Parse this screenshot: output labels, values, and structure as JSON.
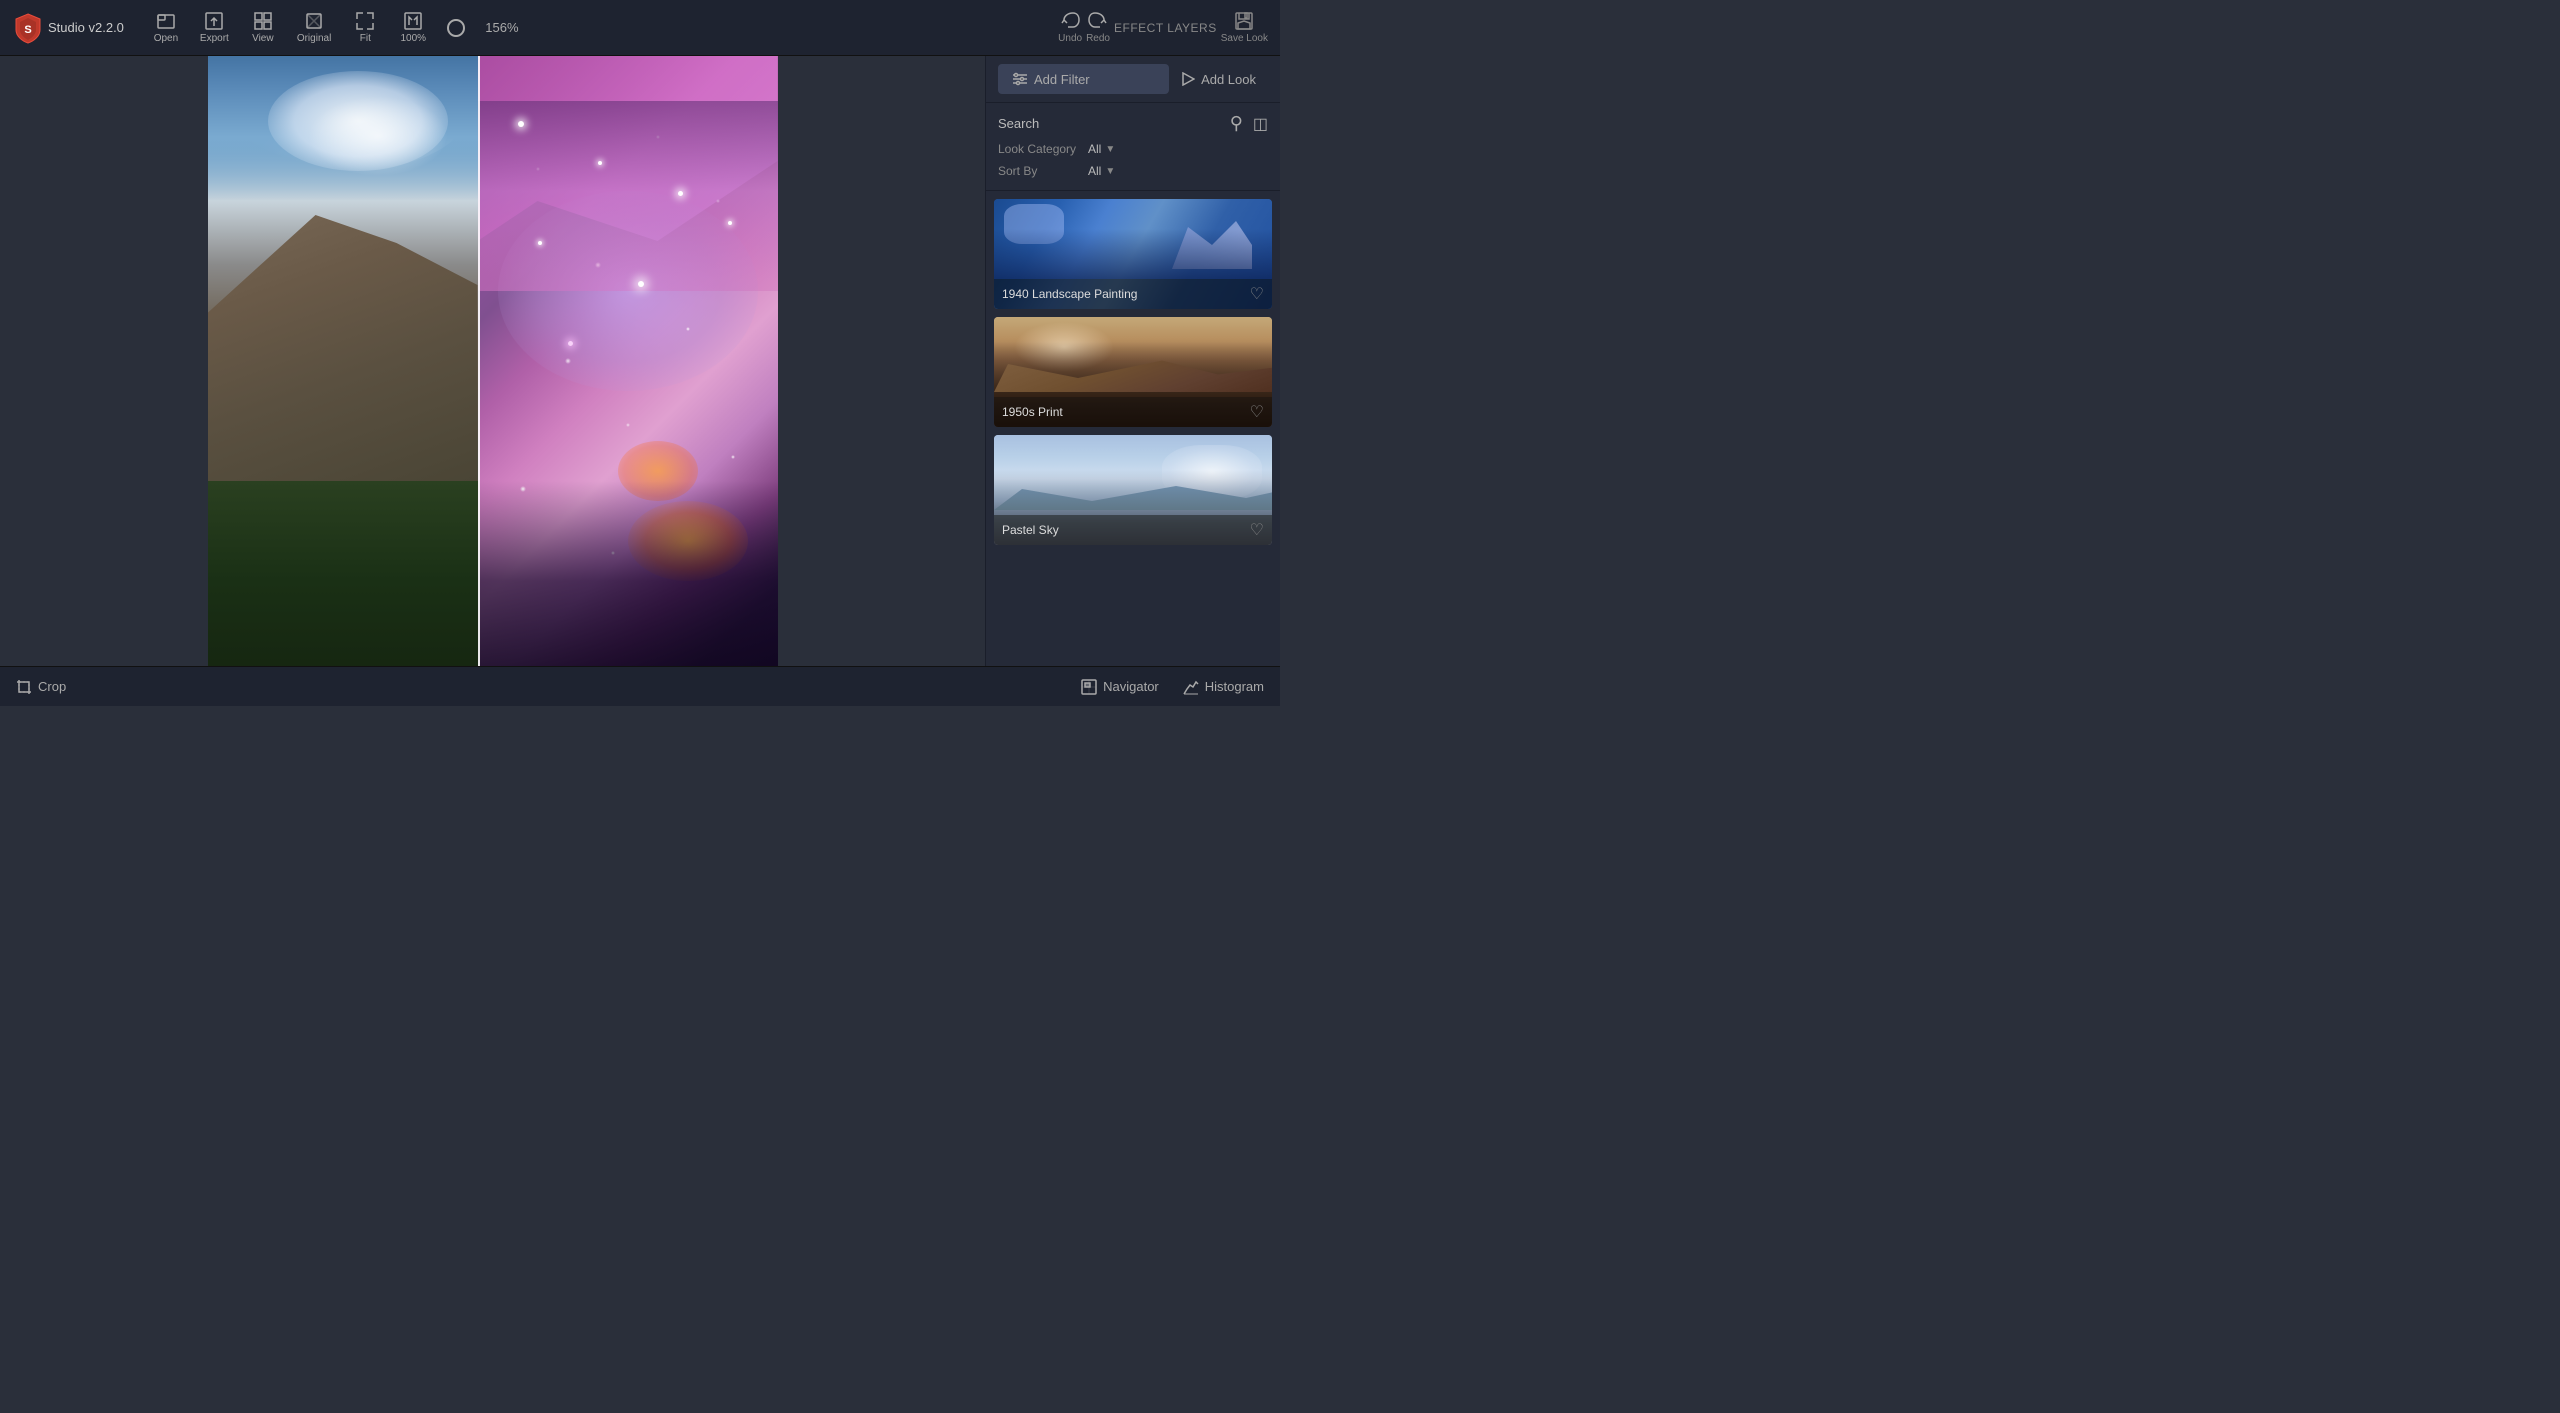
{
  "app": {
    "title": "Studio",
    "version": "v2.2.0"
  },
  "toolbar": {
    "open_label": "Open",
    "export_label": "Export",
    "view_label": "View",
    "original_label": "Original",
    "fit_label": "Fit",
    "zoom100_label": "100%",
    "undo_label": "Undo",
    "redo_label": "Redo",
    "effect_layers_label": "EFFECT LAYERS",
    "save_look_label": "Save Look",
    "zoom_level": "156%"
  },
  "right_panel": {
    "close_label": "×",
    "add_filter_label": "Add Filter",
    "add_look_label": "Add Look",
    "search_label": "Search",
    "look_category_label": "Look Category",
    "look_category_value": "All",
    "sort_by_label": "Sort By",
    "sort_by_value": "All",
    "looks": [
      {
        "name": "1940 Landscape Painting",
        "id": "look-1940-landscape"
      },
      {
        "name": "1950s Print",
        "id": "look-1950s-print"
      },
      {
        "name": "Pastel Sky",
        "id": "look-pastel-sky"
      }
    ]
  },
  "bottom_bar": {
    "crop_label": "Crop",
    "navigator_label": "Navigator",
    "histogram_label": "Histogram"
  },
  "colors": {
    "bg_dark": "#1e2330",
    "bg_main": "#252a38",
    "accent_blue": "#3a4258",
    "text_main": "#cccccc",
    "text_dim": "#888888"
  }
}
